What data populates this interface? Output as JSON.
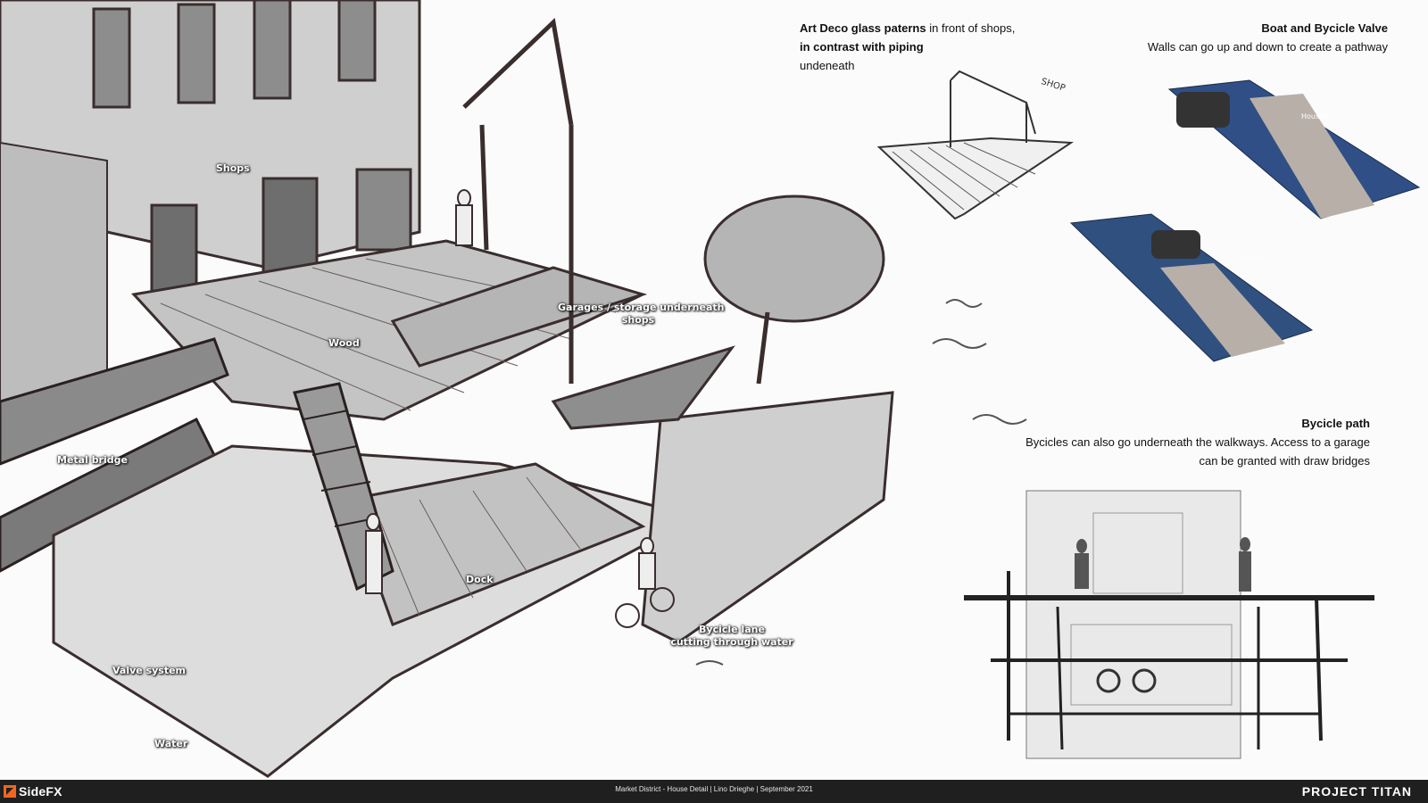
{
  "sketch_labels": {
    "shops": "Shops",
    "garages_line1": "Garages / storage underneath",
    "garages_line2": "shops",
    "wood": "Wood",
    "metal_bridge": "Metal bridge",
    "dock": "Dock",
    "bicycle_lane_line1": "Bycicle lane",
    "bicycle_lane_line2": "cutting through water",
    "valve_system": "Valve system",
    "water": "Water",
    "shop_sign": "SHOP",
    "houses_1": "Houses",
    "houses_2": "Houses"
  },
  "notes": {
    "art_deco": {
      "bold1": "Art Deco glass paterns",
      "text1": " in front of shops,",
      "bold2": "in contrast with piping",
      "text2": "undeneath"
    },
    "boat_valve": {
      "title": "Boat and Bycicle Valve",
      "text": "Walls can go up and down to create a pathway"
    },
    "bicycle_path": {
      "title": "Bycicle path",
      "line1": "Bycicles can also go underneath the walkways. Access to a garage",
      "line2": "can be granted with draw bridges"
    }
  },
  "footer": {
    "logo": "SideFX",
    "caption": "Market District - House Detail | Lino Drieghe | September 2021",
    "project": "PROJECT TITAN"
  },
  "colors": {
    "footer_bg": "#1f1f1f",
    "sidefx_orange": "#f26522",
    "water_blue": "#2f4f86"
  }
}
